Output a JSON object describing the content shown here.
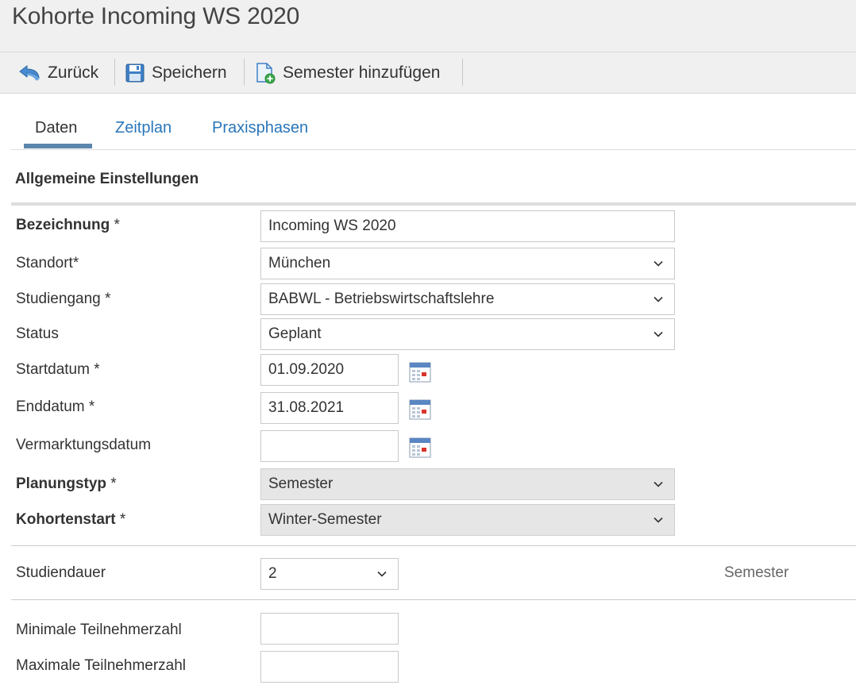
{
  "window": {
    "title": "Kohorte Incoming WS 2020"
  },
  "toolbar": {
    "back_label": "Zurück",
    "save_label": "Speichern",
    "add_semester_label": "Semester hinzufügen"
  },
  "tabs": [
    {
      "label": "Daten",
      "active": true
    },
    {
      "label": "Zeitplan",
      "active": false
    },
    {
      "label": "Praxisphasen",
      "active": false
    }
  ],
  "section": {
    "title": "Allgemeine Einstellungen"
  },
  "form": {
    "bezeichnung": {
      "label": "Bezeichnung",
      "required": "*",
      "value": "Incoming WS 2020"
    },
    "standort": {
      "label": "Standort*",
      "value": "München"
    },
    "studiengang": {
      "label": "Studiengang *",
      "value": "BABWL - Betriebswirtschaftslehre"
    },
    "status": {
      "label": "Status",
      "value": "Geplant"
    },
    "startdatum": {
      "label": "Startdatum *",
      "value": "01.09.2020"
    },
    "enddatum": {
      "label": "Enddatum *",
      "value": "31.08.2021"
    },
    "vermarktungsdatum": {
      "label": "Vermarktungsdatum",
      "value": ""
    },
    "planungstyp": {
      "label": "Planungstyp",
      "required": "*",
      "value": "Semester"
    },
    "kohortenstart": {
      "label": "Kohortenstart",
      "required": "*",
      "value": "Winter-Semester"
    },
    "studiendauer": {
      "label": "Studiendauer",
      "value": "2",
      "unit": "Semester"
    },
    "min_teilnehmer": {
      "label": "Minimale Teilnehmerzahl",
      "value": ""
    },
    "max_teilnehmer": {
      "label": "Maximale Teilnehmerzahl",
      "value": ""
    }
  },
  "colors": {
    "toolbar_bg": "#f0f0f0",
    "tab_link": "#2a76b8",
    "tab_underline": "#5b86ad",
    "disabled_field": "#e6e6e6"
  },
  "icons": {
    "back": "back-arrow-icon",
    "save": "floppy-disk-icon",
    "add_semester": "document-add-icon",
    "calendar": "calendar-icon",
    "dropdown": "chevron-down-icon"
  }
}
